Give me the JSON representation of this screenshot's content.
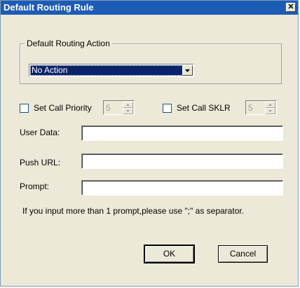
{
  "dialog": {
    "title": "Default Routing Rule",
    "close_glyph": "✕"
  },
  "routing_group": {
    "legend": "Default Routing Action",
    "selected_action": "No Action"
  },
  "priority": {
    "label": "Set Call Priority",
    "checked": false,
    "value": "5"
  },
  "sklr": {
    "label": "Set Call SKLR",
    "checked": false,
    "value": "5"
  },
  "fields": {
    "user_data_label": "User Data:",
    "user_data_value": "",
    "push_url_label": "Push URL:",
    "push_url_value": "",
    "prompt_label": "Prompt:",
    "prompt_value": ""
  },
  "hint": "If you input more than 1 prompt,please use \";\" as separator.",
  "buttons": {
    "ok": "OK",
    "cancel": "Cancel"
  },
  "colors": {
    "titlebar": "#1c5cb5",
    "dialog_bg": "#ece9d8",
    "selection": "#0a246a"
  }
}
